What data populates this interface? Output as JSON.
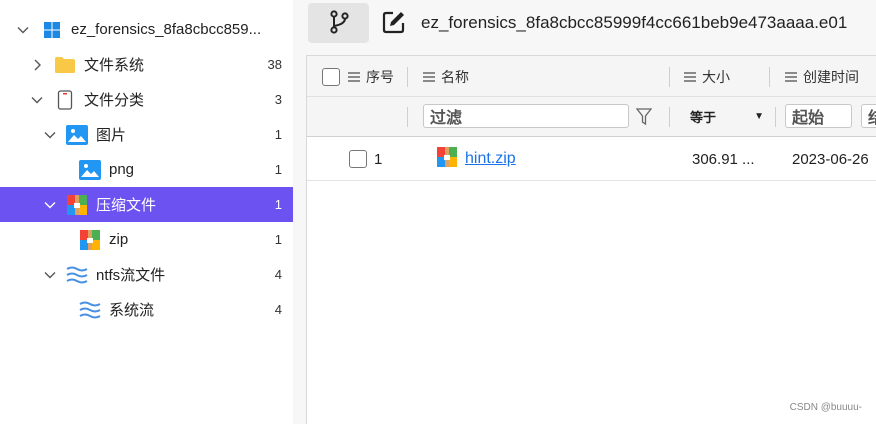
{
  "tree": {
    "items": [
      {
        "label": "ez_forensics_8fa8cbcc859...",
        "count": "",
        "icon": "windows-icon"
      },
      {
        "label": "文件系统",
        "count": "38",
        "icon": "folder-icon"
      },
      {
        "label": "文件分类",
        "count": "3",
        "icon": "phone-icon"
      },
      {
        "label": "图片",
        "count": "1",
        "icon": "image-icon"
      },
      {
        "label": "png",
        "count": "1",
        "icon": "image-icon"
      },
      {
        "label": "压缩文件",
        "count": "1",
        "icon": "archive-icon"
      },
      {
        "label": "zip",
        "count": "1",
        "icon": "archive-icon"
      },
      {
        "label": "ntfs流文件",
        "count": "4",
        "icon": "stream-icon"
      },
      {
        "label": "系统流",
        "count": "4",
        "icon": "stream-icon"
      }
    ],
    "selected_index": 5
  },
  "toolbar": {
    "title": "ez_forensics_8fa8cbcc85999f4cc661beb9e473aaaa.e01",
    "branch_icon": "branch-icon",
    "edit_icon": "edit-icon"
  },
  "grid": {
    "columns": {
      "seq": "序号",
      "name": "名称",
      "size": "大小",
      "created": "创建时间"
    },
    "filter": {
      "name_placeholder": "过滤",
      "size_op": "等于",
      "created_start": "起始",
      "created_end": "结"
    },
    "rows": [
      {
        "seq": "1",
        "name": "hint.zip",
        "size": "306.91 ...",
        "created": "2023-06-26"
      }
    ]
  },
  "watermark": "CSDN @buuuu-",
  "colors": {
    "selected_bg": "#6c52f0",
    "link": "#1a73e8",
    "panel_bg": "#f7f7f7"
  }
}
